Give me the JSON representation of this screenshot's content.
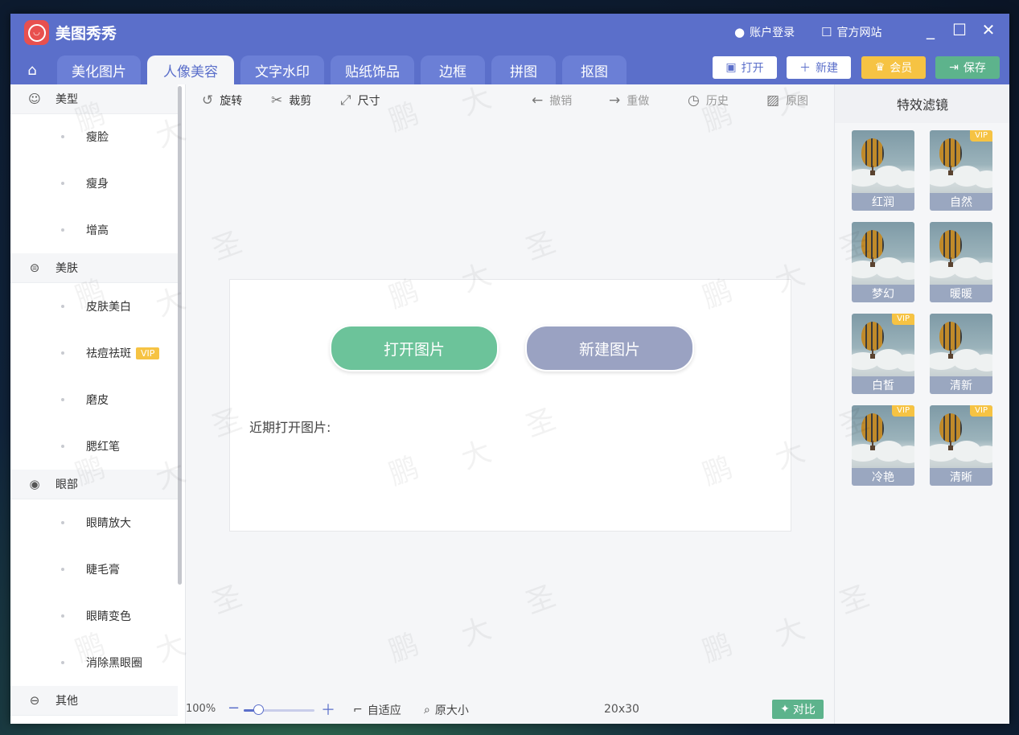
{
  "app": {
    "title": "美图秀秀",
    "account_login": "账户登录",
    "official_site": "官方网站"
  },
  "tabs": [
    {
      "label": "美化图片"
    },
    {
      "label": "人像美容"
    },
    {
      "label": "文字水印"
    },
    {
      "label": "贴纸饰品"
    },
    {
      "label": "边框"
    },
    {
      "label": "拼图"
    },
    {
      "label": "抠图"
    }
  ],
  "actions": {
    "open": "打开",
    "new": "新建",
    "vip": "会员",
    "save": "保存"
  },
  "sidebar": {
    "categories": [
      {
        "label": "美型",
        "items": [
          {
            "label": "瘦脸"
          },
          {
            "label": "瘦身"
          },
          {
            "label": "增高"
          }
        ]
      },
      {
        "label": "美肤",
        "items": [
          {
            "label": "皮肤美白"
          },
          {
            "label": "祛痘祛斑",
            "badge": "VIP"
          },
          {
            "label": "磨皮"
          },
          {
            "label": "腮红笔"
          }
        ]
      },
      {
        "label": "眼部",
        "items": [
          {
            "label": "眼睛放大"
          },
          {
            "label": "睫毛膏"
          },
          {
            "label": "眼睛变色"
          },
          {
            "label": "消除黑眼圈"
          }
        ]
      },
      {
        "label": "其他",
        "items": []
      }
    ]
  },
  "toolbar": {
    "rotate": "旋转",
    "crop": "裁剪",
    "size": "尺寸",
    "undo": "撤销",
    "redo": "重做",
    "history": "历史",
    "original": "原图"
  },
  "canvas": {
    "open_image": "打开图片",
    "new_image": "新建图片",
    "recent_label": "近期打开图片:"
  },
  "bottombar": {
    "zoom": "100%",
    "zoom_level": 0.2,
    "fit": "自适应",
    "actual_size": "原大小",
    "dimensions": "20x30",
    "compare": "对比"
  },
  "filters": {
    "title": "特效滤镜",
    "items": [
      {
        "label": "红润",
        "vip": false
      },
      {
        "label": "自然",
        "vip": true
      },
      {
        "label": "梦幻",
        "vip": false
      },
      {
        "label": "暖暖",
        "vip": false
      },
      {
        "label": "白皙",
        "vip": true
      },
      {
        "label": "清新",
        "vip": false
      },
      {
        "label": "冷艳",
        "vip": true
      },
      {
        "label": "清晰",
        "vip": true
      }
    ],
    "vip_text": "VIP"
  },
  "watermark": {
    "chars": [
      "鹏",
      "大",
      "圣"
    ]
  },
  "colors": {
    "primary": "#5b6fca",
    "open_btn": "#6cc39a",
    "new_btn": "#9aa2c2",
    "vip_gold": "#f6c343",
    "save_green": "#5db38c"
  }
}
